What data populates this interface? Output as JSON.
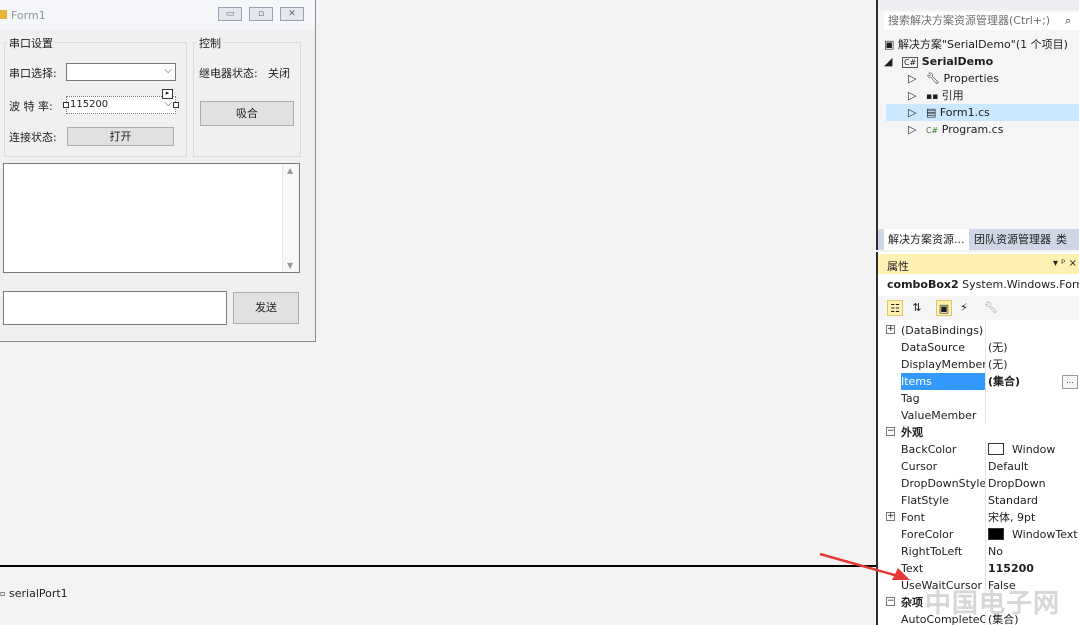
{
  "form": {
    "title": "Form1",
    "caption_buttons": [
      "▭",
      "▫",
      "✕"
    ],
    "serial_group_label": "串口设置",
    "port_label": "串口选择:",
    "port_value": "",
    "baud_label": "波 特 率:",
    "baud_value": "115200",
    "conn_label": "连接状态:",
    "open_button": "打开",
    "control_group_label": "控制",
    "relay_label": "继电器状态:",
    "relay_value": "关闭",
    "engage_button": "吸合",
    "send_button": "发送"
  },
  "tray": {
    "component": "serialPort1"
  },
  "solution_explorer": {
    "search_placeholder": "搜索解决方案资源管理器(Ctrl+;)",
    "items": [
      {
        "label": "解决方案\"SerialDemo\"(1 个项目)",
        "icon": "solution-icon"
      },
      {
        "label": "SerialDemo",
        "icon": "csharp-project-icon"
      },
      {
        "label": "Properties",
        "icon": "wrench-icon"
      },
      {
        "label": "引用",
        "icon": "references-icon"
      },
      {
        "label": "Form1.cs",
        "icon": "form-icon"
      },
      {
        "label": "Program.cs",
        "icon": "csharp-file-icon"
      }
    ],
    "tabs": [
      "解决方案资源...",
      "团队资源管理器",
      "类视"
    ]
  },
  "properties": {
    "title": "属性",
    "pin": "▾ ᵖ ×",
    "object_name": "comboBox2",
    "object_type": "System.Windows.Forms",
    "rows": [
      {
        "name": "(DataBindings)",
        "value": "",
        "expand": "⊞"
      },
      {
        "name": "DataSource",
        "value": "(无)"
      },
      {
        "name": "DisplayMember",
        "value": "(无)"
      },
      {
        "name": "Items",
        "value": "(集合)",
        "selected": true
      },
      {
        "name": "Tag",
        "value": ""
      },
      {
        "name": "ValueMember",
        "value": ""
      },
      {
        "name": "外观",
        "value": "",
        "category": true
      },
      {
        "name": "BackColor",
        "value": "Window",
        "swatch": "#ffffff"
      },
      {
        "name": "Cursor",
        "value": "Default"
      },
      {
        "name": "DropDownStyle",
        "value": "DropDown"
      },
      {
        "name": "FlatStyle",
        "value": "Standard"
      },
      {
        "name": "Font",
        "value": "宋体, 9pt",
        "expand": "⊞"
      },
      {
        "name": "ForeColor",
        "value": "WindowText",
        "swatch": "#000000"
      },
      {
        "name": "RightToLeft",
        "value": "No"
      },
      {
        "name": "Text",
        "value": "115200",
        "bold": true
      },
      {
        "name": "UseWaitCursor",
        "value": "False"
      },
      {
        "name": "杂项",
        "value": "",
        "category": true
      },
      {
        "name": "AutoCompleteC",
        "value": "(集合)"
      }
    ],
    "ellipsis": "..."
  },
  "watermark": "中国电子网",
  "colors": {
    "selection": "#3399ff",
    "properties_header": "#fff0b3",
    "arrow": "#e53935"
  }
}
